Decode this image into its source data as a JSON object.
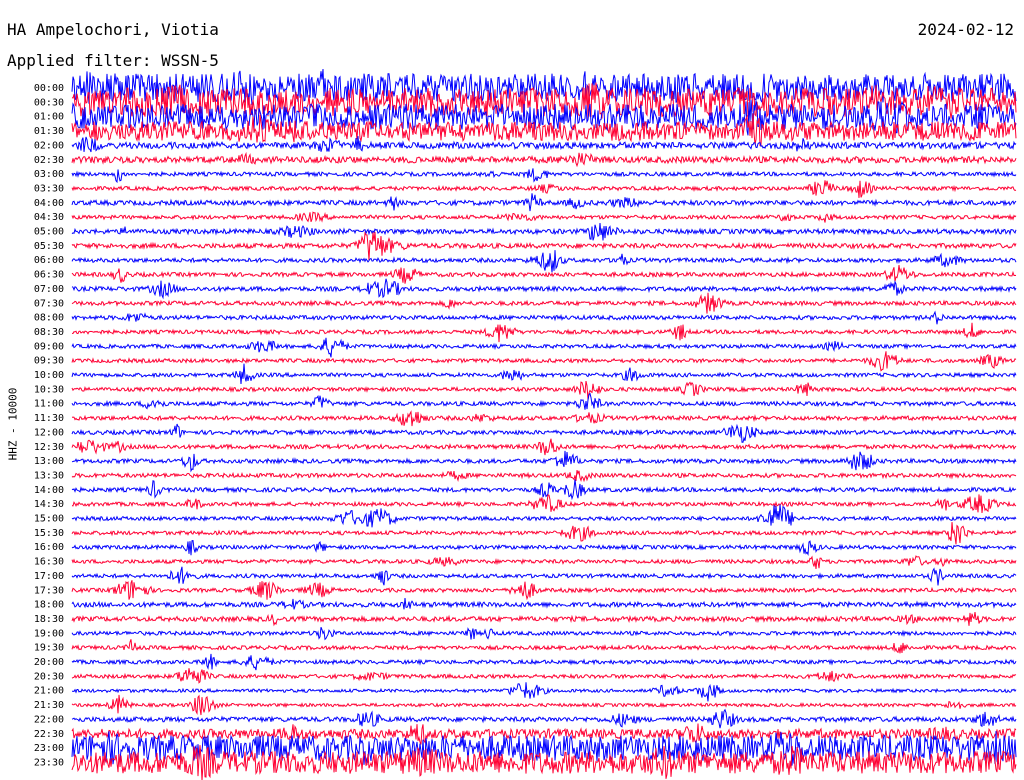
{
  "header": {
    "station": "HA Ampelochori, Viotia",
    "filter": "Applied filter: WSSN-5",
    "date": "2024-02-12",
    "channel": "HHZ - 10000"
  },
  "chart_data": {
    "type": "line",
    "title": "HA Ampelochori, Viotia",
    "subtitle": "Applied filter: WSSN-5",
    "date": "2024-02-12",
    "ylabel": "HHZ - 10000",
    "row_labels": [
      "00:00",
      "00:30",
      "01:00",
      "01:30",
      "02:00",
      "02:30",
      "03:00",
      "03:30",
      "04:00",
      "04:30",
      "05:00",
      "05:30",
      "06:00",
      "06:30",
      "07:00",
      "07:30",
      "08:00",
      "08:30",
      "09:00",
      "09:30",
      "10:00",
      "10:30",
      "11:00",
      "11:30",
      "12:00",
      "12:30",
      "13:00",
      "13:30",
      "14:00",
      "14:30",
      "15:00",
      "15:30",
      "16:00",
      "16:30",
      "17:00",
      "17:30",
      "18:00",
      "18:30",
      "19:00",
      "19:30",
      "20:00",
      "20:30",
      "21:00",
      "21:30",
      "22:00",
      "22:30",
      "23:00",
      "23:30"
    ],
    "trace_colors": [
      "#0000ff",
      "#ff0033"
    ],
    "relative_amplitude": [
      9,
      9,
      8,
      6,
      2,
      2,
      1.2,
      1.2,
      1.5,
      1.2,
      1.5,
      1.5,
      1.3,
      1.3,
      1.4,
      1.3,
      1.3,
      1.2,
      1.2,
      1.2,
      1.2,
      1.2,
      1.3,
      1.3,
      1.3,
      1.3,
      1.3,
      1.3,
      1.3,
      1.2,
      1.2,
      1.2,
      1.2,
      1.2,
      1.2,
      1.2,
      1.5,
      1.5,
      1.2,
      1.2,
      1.2,
      1.2,
      1.0,
      1.0,
      1.5,
      3,
      8,
      7
    ],
    "grid": false
  }
}
